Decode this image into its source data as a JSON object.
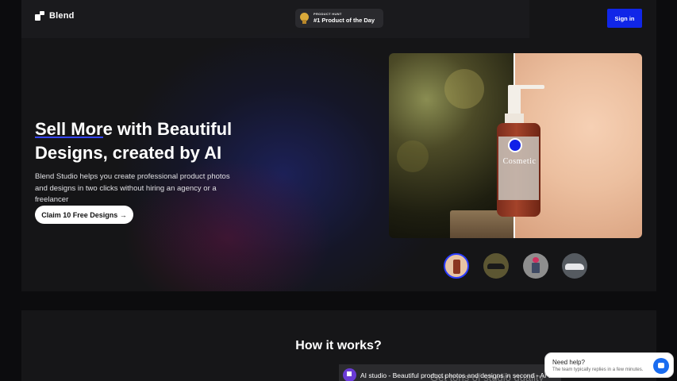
{
  "nav": {
    "logo_text": "Blend",
    "product_hunt": {
      "small_label": "PRODUCT HUNT",
      "big_label": "#1 Product of the Day"
    },
    "signin_label": "Sign in"
  },
  "hero": {
    "headline_line1": "Sell More with Beautiful",
    "headline_line2": "Designs, created by AI",
    "subtext": "Blend Studio helps you create professional product photos and designs in two clicks without hiring an agency or a freelancer",
    "cta_label": "Claim 10 Free Designs →",
    "product_text": "Cosmetic",
    "thumbnails": [
      "cosmetic-bottle",
      "sneaker",
      "cup-flower",
      "car"
    ]
  },
  "how": {
    "title": "How it works?",
    "video_title": "AI studio - Beautiful product photos and designs in second - AI art fo...",
    "video_overlay": "Get tons of studio quality"
  },
  "help_widget": {
    "title": "Need help?",
    "subtitle": "The team typically replies in a few minutes."
  },
  "colors": {
    "accent": "#1026e8",
    "background": "#0c0c0e",
    "panel": "#151517"
  }
}
